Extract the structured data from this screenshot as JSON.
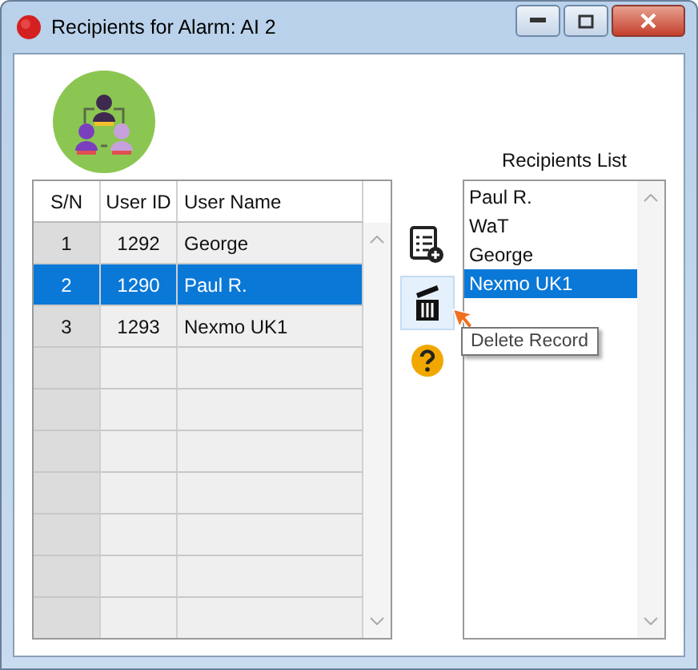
{
  "window": {
    "title": "Recipients for Alarm: AI 2"
  },
  "table": {
    "columns": [
      "S/N",
      "User ID",
      "User Name"
    ],
    "rows": [
      {
        "sn": "1",
        "user_id": "1292",
        "user_name": "George",
        "selected": false
      },
      {
        "sn": "2",
        "user_id": "1290",
        "user_name": "Paul R.",
        "selected": true
      },
      {
        "sn": "3",
        "user_id": "1293",
        "user_name": "Nexmo UK1",
        "selected": false
      }
    ]
  },
  "toolbar": [
    {
      "kind": "add",
      "hovered": false
    },
    {
      "kind": "delete",
      "hovered": true
    },
    {
      "kind": "help",
      "hovered": false
    }
  ],
  "tooltip": "Delete Record",
  "recipients": {
    "label": "Recipients List",
    "items": [
      {
        "name": "Paul R.",
        "selected": false
      },
      {
        "name": "WaT",
        "selected": false
      },
      {
        "name": "George",
        "selected": false
      },
      {
        "name": "Nexmo UK1",
        "selected": true
      }
    ]
  }
}
